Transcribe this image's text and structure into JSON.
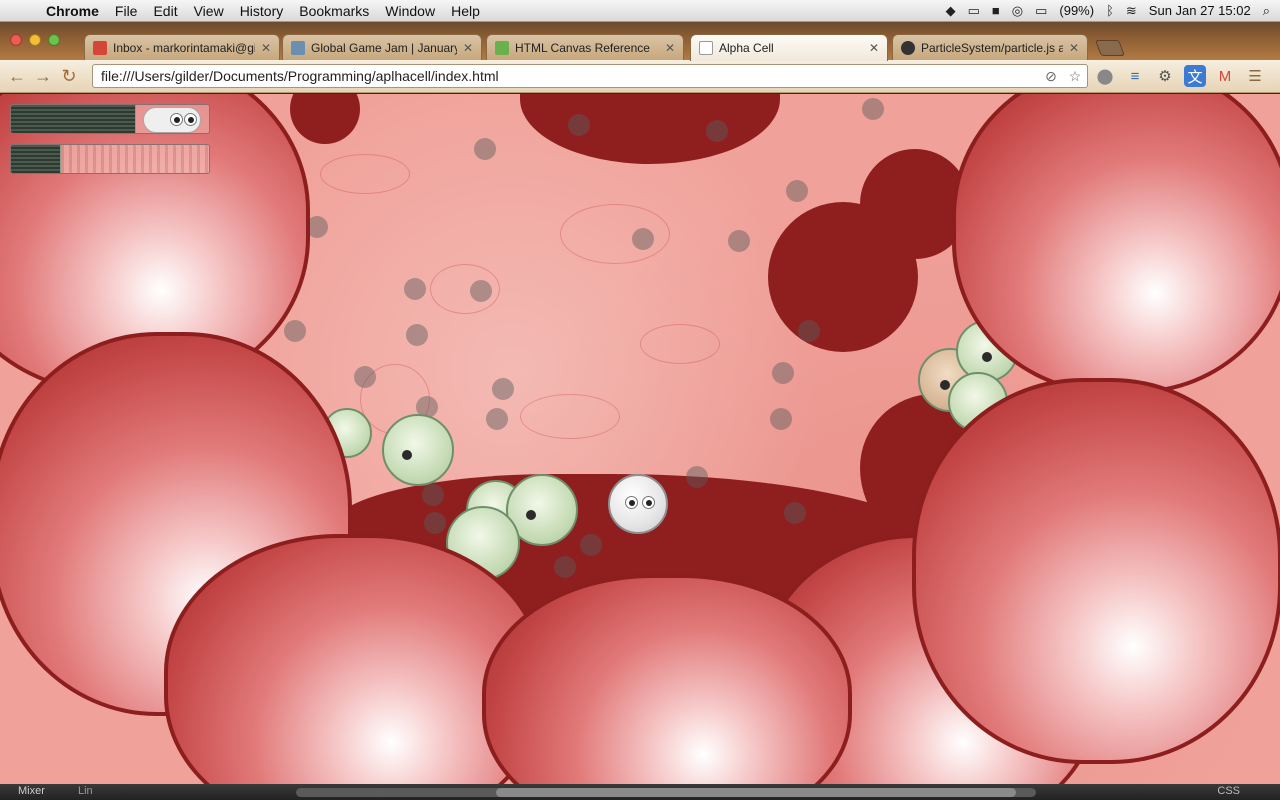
{
  "menubar": {
    "app_name": "Chrome",
    "items": [
      "File",
      "Edit",
      "View",
      "History",
      "Bookmarks",
      "Window",
      "Help"
    ],
    "battery": "(99%)",
    "clock": "Sun Jan 27  15:02"
  },
  "tabs": [
    {
      "label": "Inbox - markorintamaki@gi",
      "favicon_color": "#d44638"
    },
    {
      "label": "Global Game Jam | January",
      "favicon_color": "#6a8fb0"
    },
    {
      "label": "HTML Canvas Reference",
      "favicon_color": "#6ab04c"
    },
    {
      "label": "Alpha Cell",
      "favicon_color": "#ffffff",
      "active": true
    },
    {
      "label": "ParticleSystem/particle.js at",
      "favicon_color": "#333333"
    }
  ],
  "toolbar": {
    "url": "file:///Users/gilder/Documents/Programming/aplhacell/index.html"
  },
  "hud": {
    "health_level": 0.63,
    "energy_level": 0.25
  },
  "bottom": {
    "mixer_label": "Mixer",
    "lin_label": "Lin",
    "css_label": "CSS"
  },
  "colors": {
    "tissue": "#f0a29a",
    "dark_cell": "#8f1f1f",
    "cell_border": "#8c1e1e"
  }
}
